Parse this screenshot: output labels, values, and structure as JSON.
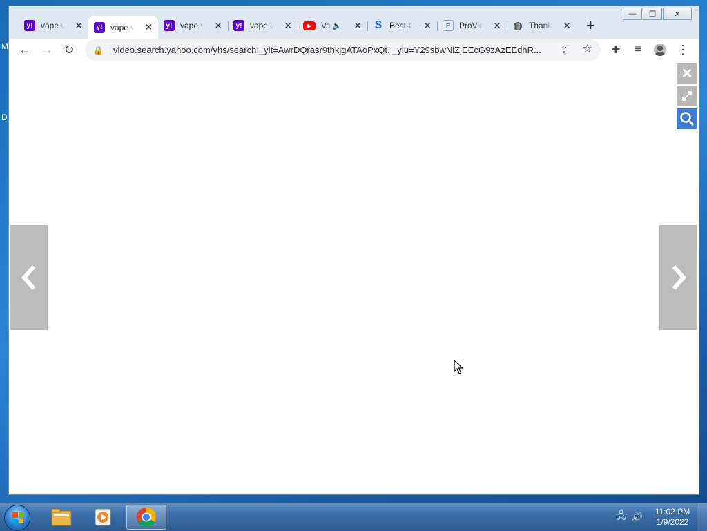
{
  "desktop": {
    "edge_letter_1": "M",
    "edge_letter_2": "D"
  },
  "window": {
    "minimize_glyph": "—",
    "maximize_glyph": "❐",
    "close_glyph": "✕"
  },
  "tabs": [
    {
      "title": "vape videos",
      "icon": "yahoo-icon",
      "favicon_text": "y!",
      "active": false
    },
    {
      "title": "vape videos",
      "icon": "yahoo-icon",
      "favicon_text": "y!",
      "active": true
    },
    {
      "title": "vape videos",
      "icon": "yahoo-icon",
      "favicon_text": "y!",
      "active": false
    },
    {
      "title": "vape videos",
      "icon": "yahoo-icon",
      "favicon_text": "y!",
      "active": false
    },
    {
      "title": "Va",
      "icon": "youtube-icon",
      "favicon_text": "▶",
      "audio": "🔈",
      "active": false
    },
    {
      "title": "Best-C",
      "icon": "best-site-icon",
      "favicon_text": "S",
      "active": false
    },
    {
      "title": "ProVid",
      "icon": "provid-icon",
      "favicon_text": "P",
      "active": false
    },
    {
      "title": "Thank",
      "icon": "globe-icon",
      "favicon_text": "◍",
      "active": false
    }
  ],
  "new_tab_label": "+",
  "tab_close_glyph": "✕",
  "toolbar": {
    "back": "←",
    "forward": "→",
    "reload": "↻",
    "lock": "🔒",
    "url": "video.search.yahoo.com/yhs/search;_ylt=AwrDQrasr9thkjgATAoPxQt.;_ylu=Y29sbwNiZjEEcG9zAzEEdnR...",
    "share": "⇪",
    "star": "☆",
    "extensions": "✚",
    "media": "≡",
    "menu": "⋮"
  },
  "viewer": {
    "close": "✕",
    "expand": "⤢",
    "search": "⚲",
    "prev": "‹",
    "next": "›"
  },
  "taskbar": {
    "apps": [
      "file-explorer",
      "media-player",
      "chrome"
    ],
    "tray_network": "🖧",
    "tray_volume": "🔊",
    "time": "11:02 PM",
    "date": "1/9/2022"
  },
  "colors": {
    "yahoo": "#6001d2",
    "youtube": "#ff0000",
    "viewer_search": "#3f7bd0",
    "viewer_gray": "#bcbcbc"
  }
}
